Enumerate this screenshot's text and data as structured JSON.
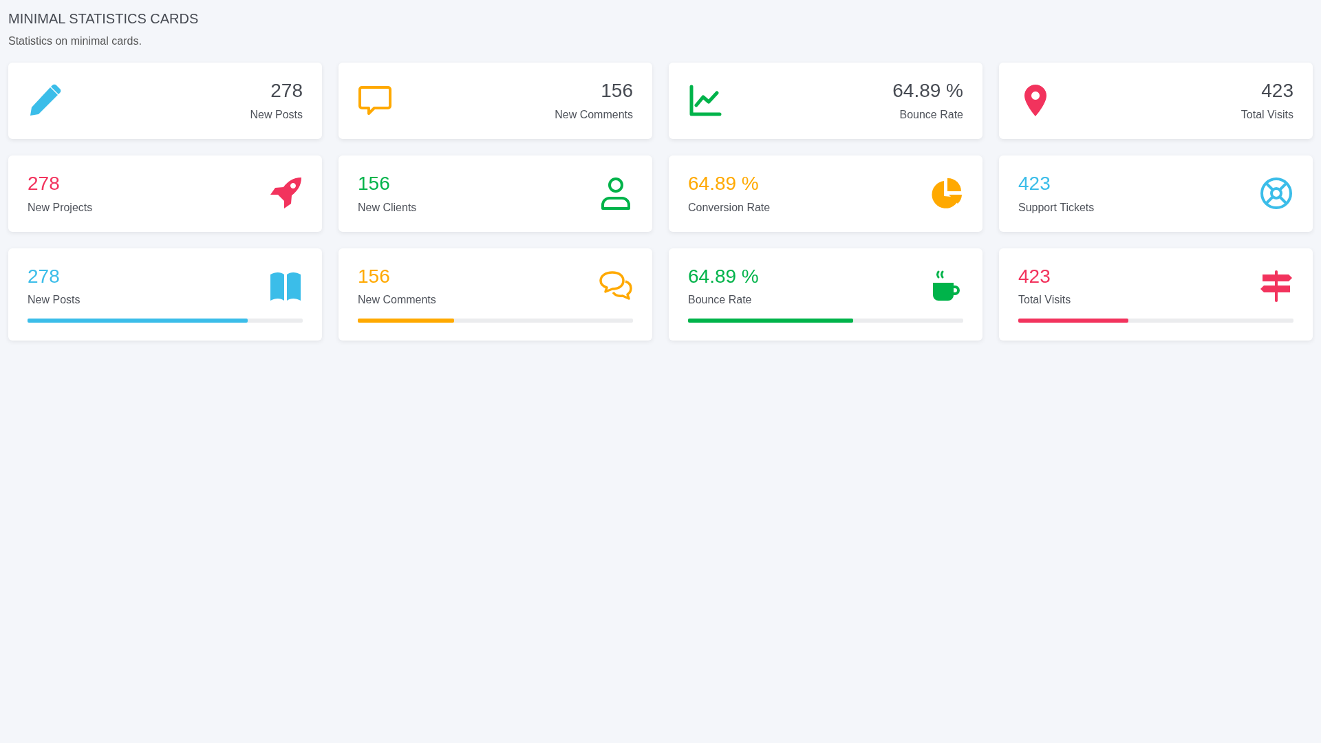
{
  "header": {
    "title": "MINIMAL STATISTICS CARDS",
    "subtitle": "Statistics on minimal cards."
  },
  "card_rows": [
    {
      "kind": "icon_left",
      "cards": [
        {
          "value": "278",
          "label": "New Posts",
          "color": "#3bbde9"
        },
        {
          "value": "156",
          "label": "New Comments",
          "color": "#ffa900"
        },
        {
          "value": "64.89 %",
          "label": "Bounce Rate",
          "color": "#00b34a"
        },
        {
          "value": "423",
          "label": "Total Visits",
          "color": "#f2335d"
        }
      ]
    },
    {
      "kind": "icon_right",
      "cards": [
        {
          "value": "278",
          "label": "New Projects",
          "color": "#f2335d"
        },
        {
          "value": "156",
          "label": "New Clients",
          "color": "#00b34a"
        },
        {
          "value": "64.89 %",
          "label": "Conversion Rate",
          "color": "#ffa900"
        },
        {
          "value": "423",
          "label": "Support Tickets",
          "color": "#3bbde9"
        }
      ]
    },
    {
      "kind": "progress",
      "cards": [
        {
          "value": "278",
          "label": "New Posts",
          "color": "#3bbde9",
          "level": 0.8
        },
        {
          "value": "156",
          "label": "New Comments",
          "color": "#ffa900",
          "level": 0.35
        },
        {
          "value": "64.89 %",
          "label": "Bounce Rate",
          "color": "#00b34a",
          "level": 0.6
        },
        {
          "value": "423",
          "label": "Total Visits",
          "color": "#f2335d",
          "level": 0.4
        }
      ]
    }
  ]
}
